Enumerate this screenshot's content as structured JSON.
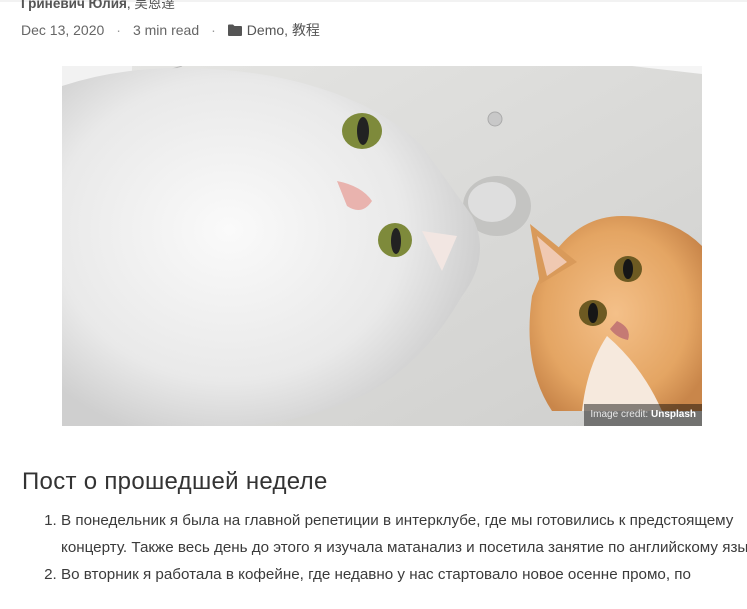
{
  "post": {
    "author_1": "Гриневич Юлия",
    "author_sep": ",",
    "author_2": "吴恩達",
    "date": "Dec 13, 2020",
    "separator": "·",
    "read_time": "3 min read",
    "categories": [
      {
        "label": "Demo",
        "sep": ","
      },
      {
        "label": "教程",
        "sep": ""
      }
    ]
  },
  "hero_image": {
    "alt": "Two cats looking down at the camera",
    "credit_prefix": "Image credit:",
    "credit_source": "Unsplash"
  },
  "content": {
    "heading": "Пост о прошедшей неделе",
    "list": [
      "В понедельник я была на главной репетиции в интерклубе, где мы готовились к предстоящему концерту. Также весь день до этого я изучала матанализ и посетила занятие по английскому языку.",
      "Во вторник я работала в кофейне, где недавно у нас стартовало новое осенне промо, по"
    ]
  },
  "icons": {
    "category": "folder-icon"
  },
  "colors": {
    "text": "#3b3b3b",
    "meta": "#666666",
    "credit_bg": "#000000"
  }
}
